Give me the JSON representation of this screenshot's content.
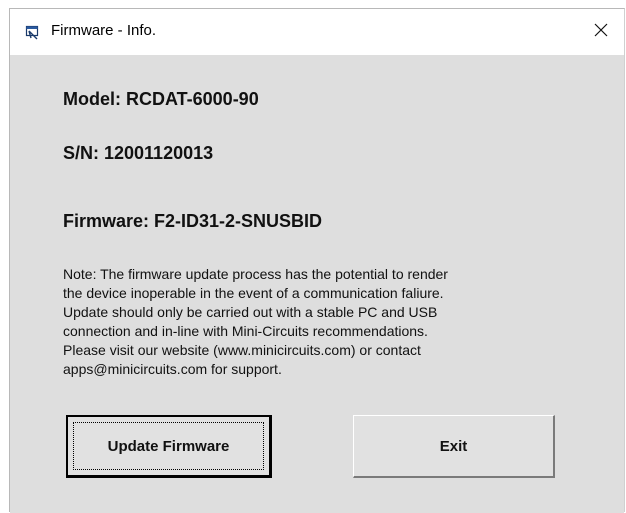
{
  "window": {
    "title": "Firmware - Info.",
    "icon": "window-app-icon",
    "close_icon": "close-icon"
  },
  "device": {
    "model": "Model: RCDAT-6000-90",
    "serial": "S/N: 12001120013",
    "firmware": "Firmware: F2-ID31-2-SNUSBID"
  },
  "note": {
    "lines": [
      "Note: The firmware update process has the potential to render",
      "the device inoperable in the event of a communication faliure.",
      "Update should only be carried out with a stable PC and USB",
      "connection and in-line with Mini-Circuits recommendations.",
      "Please visit our website (www.minicircuits.com) or contact",
      "apps@minicircuits.com for support."
    ]
  },
  "buttons": {
    "update_label": "Update Firmware",
    "exit_label": "Exit"
  }
}
